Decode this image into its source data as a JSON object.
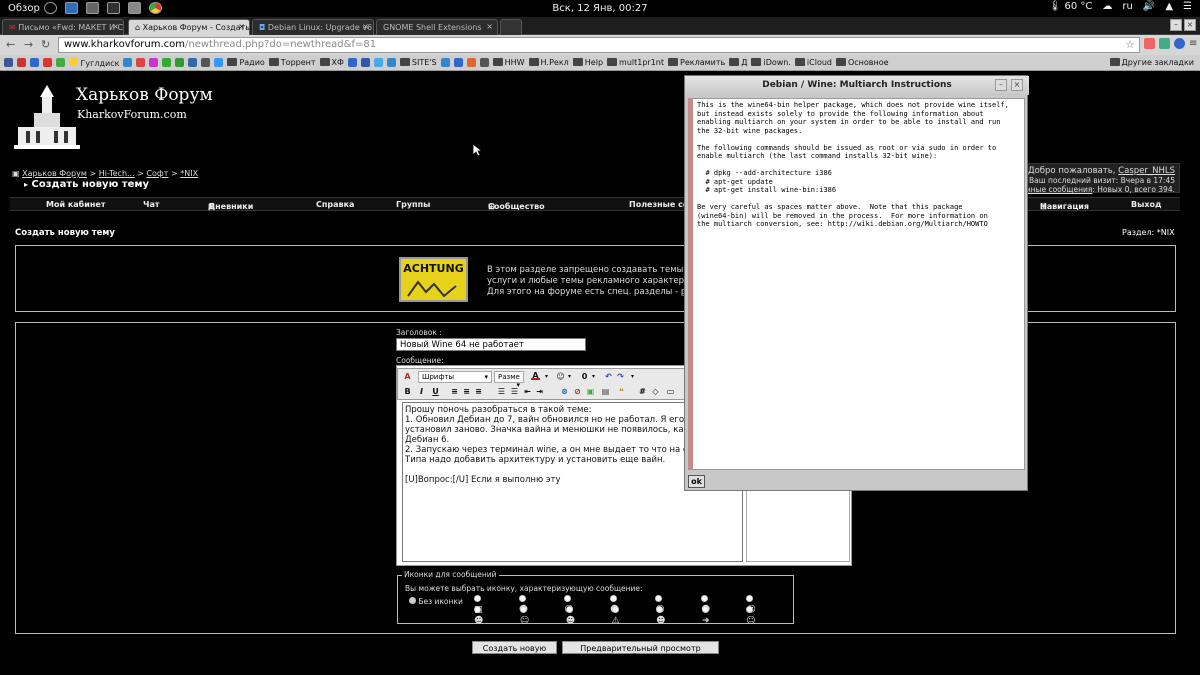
{
  "topbar": {
    "overview": "Обзор",
    "clock": "Вск, 12 Янв, 00:27",
    "temp": "60 °C",
    "lang": "ru"
  },
  "tabs": [
    {
      "title": "Письмо «Fwd: МАКЕТ И С"
    },
    {
      "title": "Харьков Форум - Создать"
    },
    {
      "title": "Debian Linux: Upgrade v6."
    },
    {
      "title": "GNOME Shell Extensions"
    }
  ],
  "address": {
    "host": "www.kharkovforum.com",
    "path": "/newthread.php?do=newthread&f=81"
  },
  "bookmarks": [
    "Гуглдиск",
    "Радио",
    "Торрент",
    "ХФ",
    "SITE'S",
    "HHW",
    "Н.Рекл",
    "Help",
    "mult1pr1nt",
    "Рекламить",
    "Д",
    "iDown.",
    "iCloud",
    "Основное",
    "Другие закладки"
  ],
  "forum": {
    "logo_title": "Харьков Форум",
    "logo_sub": "KharkovForum.com",
    "breadcrumb": [
      "Харьков Форум",
      "Hi-Tech...",
      "Софт",
      "*NIX"
    ],
    "page_heading": "Создать новую тему",
    "welcome": "Добро пожаловать,",
    "user": "Casper_NHLS",
    "last_visit": "Ваш последний визит: Вчера в 17:45",
    "pm": "Личные сообщения",
    "pm_counts": ": Новых 0, всего 394.",
    "nav": [
      "Мой кабинет",
      "Чат",
      "Дневники",
      "Справка",
      "Группы",
      "Сообщество",
      "Полезные ссы",
      "Навигация",
      "Выход"
    ],
    "section_title": "Создать новую тему",
    "section_label": "Раздел: *NIX",
    "achtung_label": "ACHTUNG",
    "notice_line1": "В этом разделе запрещено создавать темы ку",
    "notice_line2": "услуги и любые темы рекламного характера.",
    "notice_line3": "Для этого на форуме есть спец. разделы - ",
    "notice_link": "р",
    "title_label": "Заголовок :",
    "title_value": "Новый Wine 64 не работает",
    "message_label": "Сообщение:",
    "font_select": "Шрифты",
    "size_select": "Разме",
    "message_text": "Прошу поночь разобраться в такой теме:\n1. Обновил Дебиан до 7, вайн обновился но не работал. Я его сн\nустановил заново. Значка вайна и менюшки не появилось, как з\nДебиан 6.\n2. Запускаю через терминал wine, а он мне выдает то что на скр\nТипа надо добавить архитектуру и установить еще вайн.\n\n[U]Вопрос:[/U] Если я выполню эту",
    "icons_legend": "Иконки для сообщений",
    "icons_hint": "Вы можете выбрать иконку, характеризующую сообщение:",
    "no_icon": "Без иконки",
    "submit": "Создать новую тему",
    "preview": "Предварительный просмотр сообщения"
  },
  "dialog": {
    "title": "Debian / Wine: Multiarch Instructions",
    "text": "This is the wine64-bin helper package, which does not provide wine itself,\nbut instead exists solely to provide the following information about\nenabling multiarch on your system in order to be able to install and run\nthe 32-bit wine packages.\n\nThe following commands should be issued as root or via sudo in order to\nenable multiarch (the last command installs 32-bit wine):\n\n  # dpkg --add-architecture i386\n  # apt-get update\n  # apt-get install wine-bin:i386\n\nBe very careful as spaces matter above.  Note that this package\n(wine64-bin) will be removed in the process.  For more information on\nthe multiarch conversion, see: http://wiki.debian.org/Multiarch/HOWTO",
    "ok": "ok"
  }
}
